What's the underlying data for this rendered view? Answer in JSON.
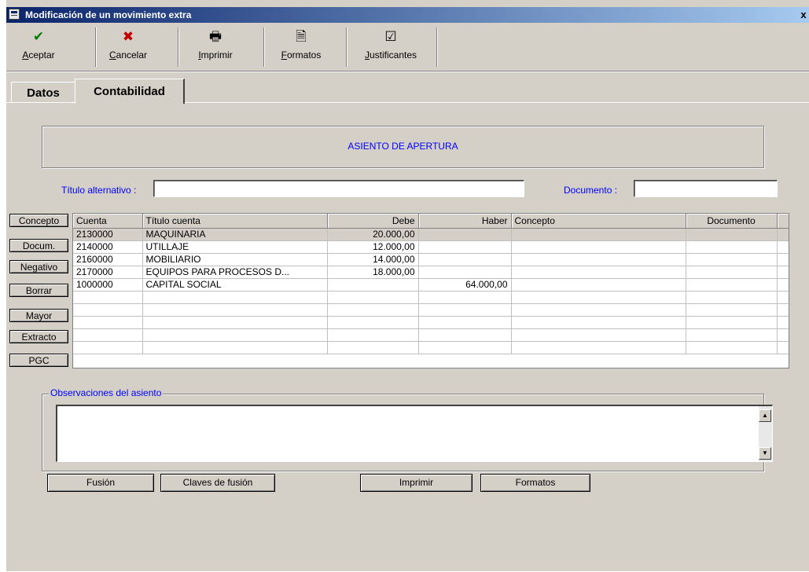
{
  "window": {
    "title": "Modificación de un movimiento extra",
    "close_glyph": "x"
  },
  "toolbar": [
    {
      "name": "aceptar-button",
      "icon": "check-icon",
      "glyph": "✔",
      "color": "#008000",
      "label": "Aceptar",
      "key": "A",
      "rest": "ceptar"
    },
    {
      "name": "cancelar-button",
      "icon": "cross-icon",
      "glyph": "✖",
      "color": "#c00000",
      "label": "Cancelar",
      "key": "C",
      "rest": "ancelar"
    },
    {
      "name": "imprimir-button",
      "icon": "printer-icon",
      "glyph": "🖶",
      "color": "#000000",
      "label": "Imprimir",
      "key": "I",
      "rest": "mprimir"
    },
    {
      "name": "formatos-button",
      "icon": "document-icon",
      "glyph": "🗎",
      "color": "#000000",
      "label": "Formatos",
      "key": "F",
      "rest": "ormatos"
    },
    {
      "name": "justificantes-button",
      "icon": "checkbox-doc-icon",
      "glyph": "☑",
      "color": "#000000",
      "label": "Justificantes",
      "key": "J",
      "rest": "ustificantes"
    }
  ],
  "tabs": {
    "datos": "Datos",
    "contabilidad": "Contabilidad"
  },
  "banner": "ASIENTO DE APERTURA",
  "form": {
    "titulo_label": "Título alternativo :",
    "titulo_value": "",
    "documento_label": "Documento :",
    "documento_value": ""
  },
  "side_buttons": [
    "Concepto",
    "Docum.",
    "Negativo",
    "Borrar",
    "Mayor",
    "Extracto",
    "PGC"
  ],
  "grid": {
    "headers": [
      "Cuenta",
      "Título cuenta",
      "Debe",
      "Haber",
      "Concepto",
      "Documento",
      ""
    ],
    "rows": [
      [
        "2130000",
        "MAQUINARIA",
        "20.000,00",
        "",
        "",
        "",
        ""
      ],
      [
        "2140000",
        "UTILLAJE",
        "12.000,00",
        "",
        "",
        "",
        ""
      ],
      [
        "2160000",
        "MOBILIARIO",
        "14.000,00",
        "",
        "",
        "",
        ""
      ],
      [
        "2170000",
        "EQUIPOS PARA PROCESOS D...",
        "18.000,00",
        "",
        "",
        "",
        ""
      ],
      [
        "1000000",
        "CAPITAL SOCIAL",
        "",
        "64.000,00",
        "",
        "",
        ""
      ],
      [
        "",
        "",
        "",
        "",
        "",
        "",
        ""
      ],
      [
        "",
        "",
        "",
        "",
        "",
        "",
        ""
      ],
      [
        "",
        "",
        "",
        "",
        "",
        "",
        ""
      ],
      [
        "",
        "",
        "",
        "",
        "",
        "",
        ""
      ],
      [
        "",
        "",
        "",
        "",
        "",
        "",
        ""
      ]
    ]
  },
  "observaciones": {
    "label": "Observaciones del asiento",
    "value": ""
  },
  "bottom_buttons": {
    "fusion": "Fusión",
    "claves": "Claves de fusión",
    "imprimir": "Imprimir",
    "formatos": "Formatos"
  }
}
